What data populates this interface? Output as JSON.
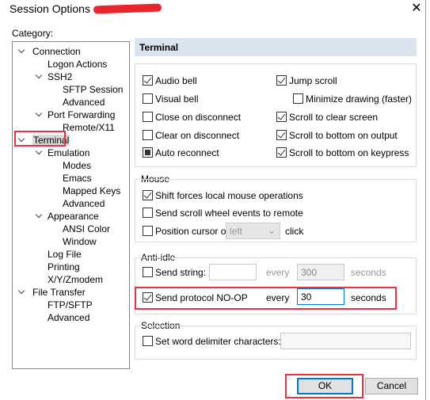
{
  "window": {
    "title": "Session Options",
    "close_icon": "close-icon"
  },
  "category_label": "Category:",
  "tree": [
    {
      "label": "Connection",
      "level": 0,
      "expanded": true
    },
    {
      "label": "Logon Actions",
      "level": 1
    },
    {
      "label": "SSH2",
      "level": 1,
      "expanded": true
    },
    {
      "label": "SFTP Session",
      "level": 2
    },
    {
      "label": "Advanced",
      "level": 2
    },
    {
      "label": "Port Forwarding",
      "level": 1,
      "expanded": true
    },
    {
      "label": "Remote/X11",
      "level": 2
    },
    {
      "label": "Terminal",
      "level": 0,
      "expanded": true,
      "selected": true
    },
    {
      "label": "Emulation",
      "level": 1,
      "expanded": true
    },
    {
      "label": "Modes",
      "level": 2
    },
    {
      "label": "Emacs",
      "level": 2
    },
    {
      "label": "Mapped Keys",
      "level": 2
    },
    {
      "label": "Advanced",
      "level": 2
    },
    {
      "label": "Appearance",
      "level": 1,
      "expanded": true
    },
    {
      "label": "ANSI Color",
      "level": 2
    },
    {
      "label": "Window",
      "level": 2
    },
    {
      "label": "Log File",
      "level": 1
    },
    {
      "label": "Printing",
      "level": 1
    },
    {
      "label": "X/Y/Zmodem",
      "level": 1
    },
    {
      "label": "File Transfer",
      "level": 0,
      "expanded": true
    },
    {
      "label": "FTP/SFTP",
      "level": 1
    },
    {
      "label": "Advanced",
      "level": 1
    }
  ],
  "panel_title": "Terminal",
  "terminal": {
    "left": [
      {
        "label": "Audio bell",
        "state": "checked"
      },
      {
        "label": "Visual bell",
        "state": "unchecked"
      },
      {
        "label": "Close on disconnect",
        "state": "unchecked"
      },
      {
        "label": "Clear on disconnect",
        "state": "unchecked"
      },
      {
        "label": "Auto reconnect",
        "state": "indeterminate"
      }
    ],
    "right": [
      {
        "label": "Jump scroll",
        "state": "checked"
      },
      {
        "label": "Minimize drawing (faster)",
        "state": "unchecked"
      },
      {
        "label": "Scroll to clear screen",
        "state": "checked"
      },
      {
        "label": "Scroll to bottom on output",
        "state": "checked"
      },
      {
        "label": "Scroll to bottom on keypress",
        "state": "checked"
      }
    ]
  },
  "mouse": {
    "title": "Mouse",
    "shift": "Shift forces local mouse operations",
    "scroll": "Send scroll wheel events to remote",
    "position": "Position cursor on",
    "position_value": "left",
    "click": "click"
  },
  "anti_idle": {
    "title": "Anti-idle",
    "send_string": "Send string:",
    "send_string_value": "",
    "every": "every",
    "string_interval": "300",
    "seconds": "seconds",
    "noop": "Send protocol NO-OP",
    "noop_interval": "30"
  },
  "selection": {
    "title": "Selection",
    "delimiter": "Set word delimiter characters:",
    "delimiter_value": ""
  },
  "buttons": {
    "ok": "OK",
    "cancel": "Cancel"
  },
  "colors": {
    "highlight": "#e8343f",
    "header": "#dae4ef",
    "focus": "#0078d7"
  }
}
